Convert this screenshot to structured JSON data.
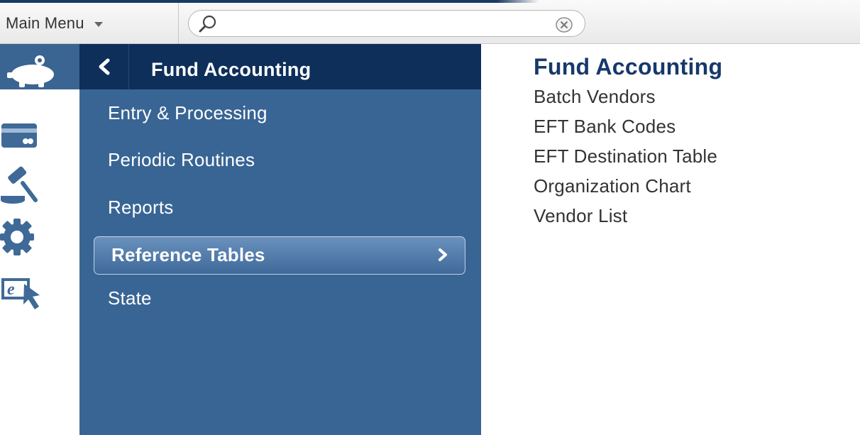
{
  "toolbar": {
    "main_menu_label": "Main Menu",
    "search": {
      "value": "",
      "placeholder": ""
    }
  },
  "rail": {
    "icons": [
      "piggy-bank-icon",
      "credit-card-icon",
      "gavel-icon",
      "gear-icon",
      "e-cursor-icon"
    ],
    "active_index": 0
  },
  "nav": {
    "title": "Fund Accounting",
    "items": [
      {
        "label": "Entry & Processing"
      },
      {
        "label": "Periodic Routines"
      },
      {
        "label": "Reports"
      },
      {
        "label": "Reference Tables"
      },
      {
        "label": "State"
      }
    ],
    "selected_index": 3
  },
  "content": {
    "title": "Fund Accounting",
    "links": [
      {
        "label": "Batch Vendors"
      },
      {
        "label": "EFT Bank Codes"
      },
      {
        "label": "EFT Destination Table"
      },
      {
        "label": "Organization Chart"
      },
      {
        "label": "Vendor List"
      }
    ]
  },
  "colors": {
    "header_navy": "#0e2f5a",
    "panel_blue": "#386594",
    "title_navy": "#17386a",
    "icon_blue": "#3a6491"
  }
}
